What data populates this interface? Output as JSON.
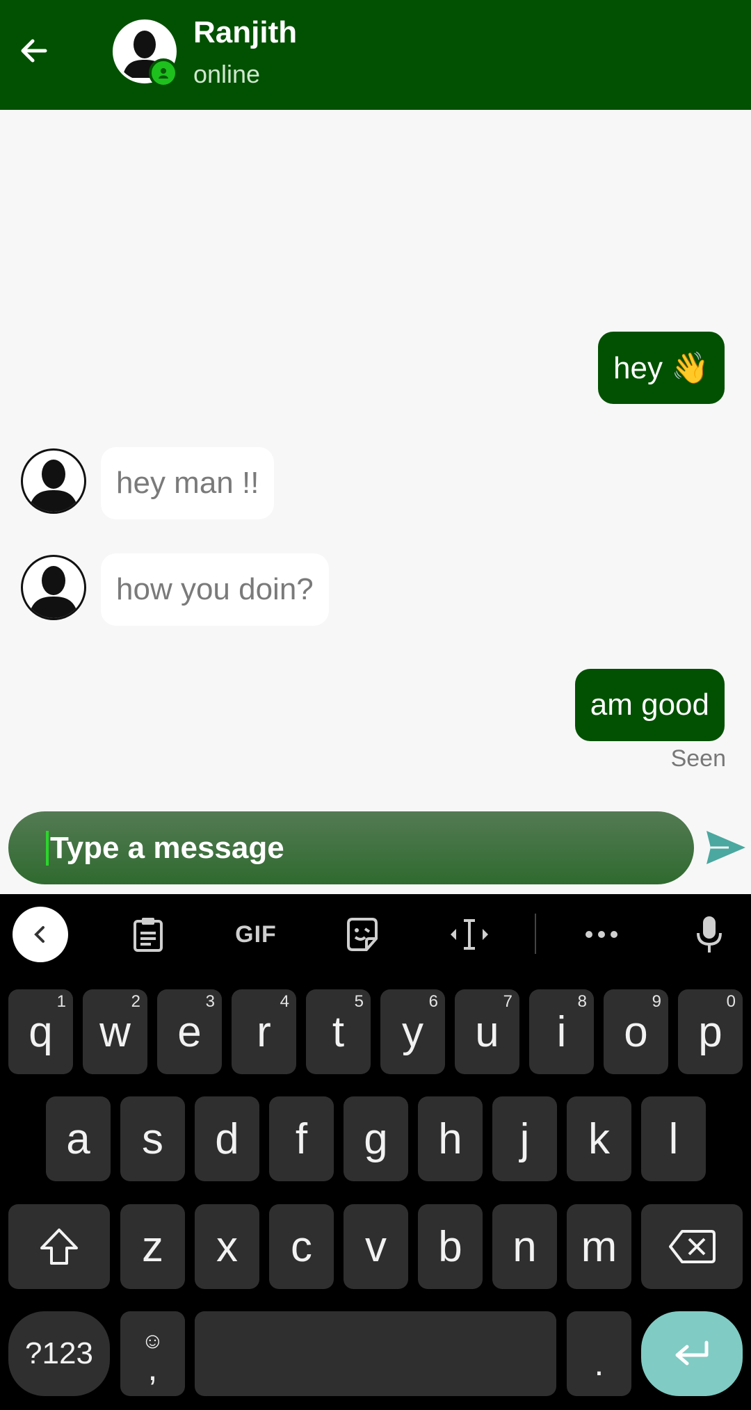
{
  "header": {
    "contact_name": "Ranjith",
    "status": "online",
    "colors": {
      "bar": "#025102",
      "online_dot": "#1ec01e"
    }
  },
  "messages": [
    {
      "direction": "out",
      "text": "hey 👋"
    },
    {
      "direction": "in",
      "text": "hey man !!"
    },
    {
      "direction": "in",
      "text": "how you doin?"
    },
    {
      "direction": "out",
      "text": "am good",
      "receipt": "Seen"
    }
  ],
  "composer": {
    "placeholder": "Type a message",
    "value": ""
  },
  "keyboard": {
    "toolbar": {
      "gif_label": "GIF"
    },
    "row1": [
      {
        "key": "q",
        "hint": "1"
      },
      {
        "key": "w",
        "hint": "2"
      },
      {
        "key": "e",
        "hint": "3"
      },
      {
        "key": "r",
        "hint": "4"
      },
      {
        "key": "t",
        "hint": "5"
      },
      {
        "key": "y",
        "hint": "6"
      },
      {
        "key": "u",
        "hint": "7"
      },
      {
        "key": "i",
        "hint": "8"
      },
      {
        "key": "o",
        "hint": "9"
      },
      {
        "key": "p",
        "hint": "0"
      }
    ],
    "row2": [
      "a",
      "s",
      "d",
      "f",
      "g",
      "h",
      "j",
      "k",
      "l"
    ],
    "row3": [
      "z",
      "x",
      "c",
      "v",
      "b",
      "n",
      "m"
    ],
    "symbols_label": "?123",
    "comma_label": ",",
    "emoji_label": "☺",
    "period_label": "."
  }
}
